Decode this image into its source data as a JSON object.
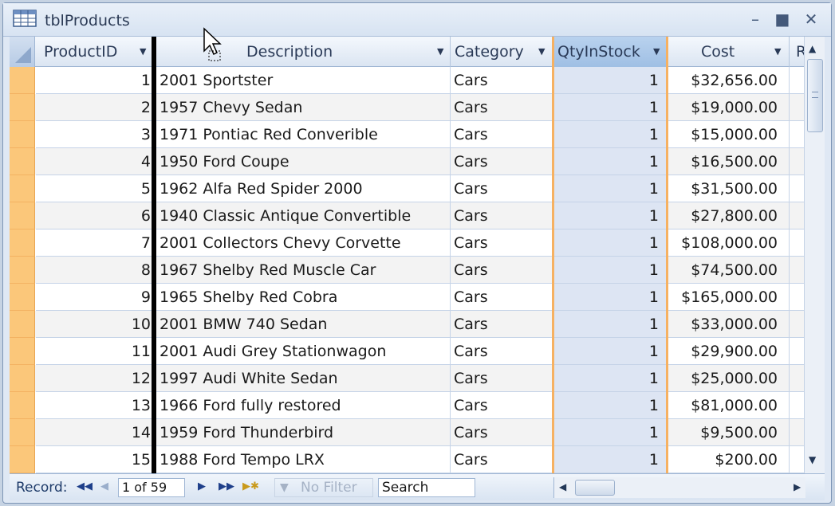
{
  "window": {
    "title": "tblProducts",
    "min_icon": "minimize-icon",
    "max_icon": "maximize-icon",
    "close_icon": "close-icon"
  },
  "columns": {
    "product_id": "ProductID",
    "description": "Description",
    "category": "Category",
    "qty": "QtyInStock",
    "cost": "Cost",
    "next": "R"
  },
  "rows": [
    {
      "id": "1",
      "description": "2001 Sportster",
      "category": "Cars",
      "qty": "1",
      "cost": "$32,656.00"
    },
    {
      "id": "2",
      "description": "1957 Chevy Sedan",
      "category": "Cars",
      "qty": "1",
      "cost": "$19,000.00"
    },
    {
      "id": "3",
      "description": "1971 Pontiac Red Converible",
      "category": "Cars",
      "qty": "1",
      "cost": "$15,000.00"
    },
    {
      "id": "4",
      "description": "1950 Ford Coupe",
      "category": "Cars",
      "qty": "1",
      "cost": "$16,500.00"
    },
    {
      "id": "5",
      "description": "1962 Alfa Red Spider 2000",
      "category": "Cars",
      "qty": "1",
      "cost": "$31,500.00"
    },
    {
      "id": "6",
      "description": "1940 Classic Antique Convertible",
      "category": "Cars",
      "qty": "1",
      "cost": "$27,800.00"
    },
    {
      "id": "7",
      "description": "2001 Collectors Chevy Corvette",
      "category": "Cars",
      "qty": "1",
      "cost": "$108,000.00"
    },
    {
      "id": "8",
      "description": "1967 Shelby Red Muscle Car",
      "category": "Cars",
      "qty": "1",
      "cost": "$74,500.00"
    },
    {
      "id": "9",
      "description": "1965 Shelby Red Cobra",
      "category": "Cars",
      "qty": "1",
      "cost": "$165,000.00"
    },
    {
      "id": "10",
      "description": "2001 BMW 740 Sedan",
      "category": "Cars",
      "qty": "1",
      "cost": "$33,000.00"
    },
    {
      "id": "11",
      "description": "2001 Audi Grey Stationwagon",
      "category": "Cars",
      "qty": "1",
      "cost": "$29,900.00"
    },
    {
      "id": "12",
      "description": "1997 Audi White Sedan",
      "category": "Cars",
      "qty": "1",
      "cost": "$25,000.00"
    },
    {
      "id": "13",
      "description": "1966 Ford fully restored",
      "category": "Cars",
      "qty": "1",
      "cost": "$81,000.00"
    },
    {
      "id": "14",
      "description": "1959 Ford Thunderbird",
      "category": "Cars",
      "qty": "1",
      "cost": "$9,500.00"
    },
    {
      "id": "15",
      "description": "1988 Ford Tempo  LRX",
      "category": "Cars",
      "qty": "1",
      "cost": "$200.00"
    }
  ],
  "navigation": {
    "record_label": "Record:",
    "record_position": "1 of 59",
    "filter_label": "No Filter",
    "search_value": "Search"
  },
  "colors": {
    "row_selector": "#fbc77a",
    "selected_column": "#dde5f3",
    "selected_column_border": "#f6b162"
  }
}
